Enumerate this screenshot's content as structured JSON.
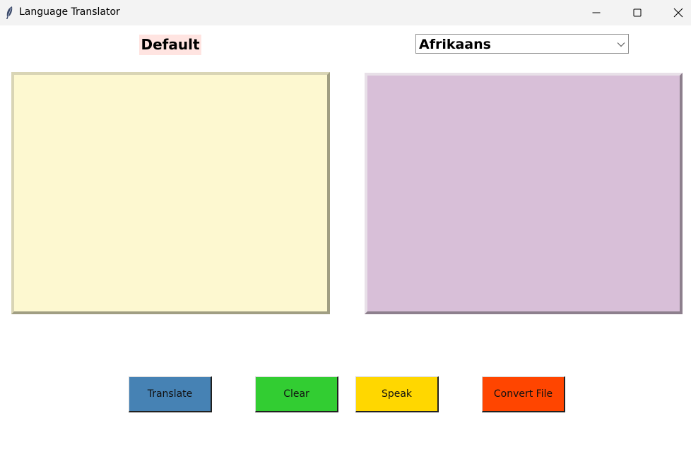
{
  "window": {
    "title": "Language Translator",
    "icon": "feather-icon"
  },
  "source": {
    "label": "Default"
  },
  "target": {
    "selected_language": "Afrikaans"
  },
  "input_text": "",
  "output_text": "",
  "buttons": {
    "translate": "Translate",
    "clear": "Clear",
    "speak": "Speak",
    "convert_file": "Convert File"
  },
  "colors": {
    "source_label_bg": "#ffe4e1",
    "input_bg": "#fdf8d0",
    "output_bg": "#d8bfd8",
    "translate": "#4682b4",
    "clear": "#32cd32",
    "speak": "#ffd700",
    "convert_file": "#ff4500"
  }
}
